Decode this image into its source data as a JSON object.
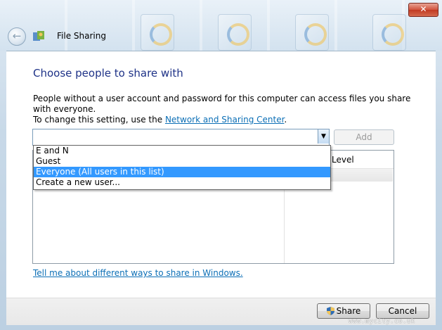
{
  "window": {
    "close_label": "✕",
    "back_icon": "back-arrow-icon",
    "title": "File Sharing"
  },
  "content": {
    "heading": "Choose people to share with",
    "description_line1": "People without a user account and password for this computer can access files you share with everyone.",
    "description_line2_prefix": "To change this setting, use the ",
    "network_link": "Network and Sharing Center",
    "description_line2_suffix": "."
  },
  "user_combo": {
    "value": "",
    "add_label": "Add"
  },
  "dropdown": {
    "options": [
      "E and N",
      "Guest",
      "Everyone (All users in this list)",
      "Create a new user..."
    ],
    "selected_index": 2
  },
  "list": {
    "permission_header": "Level"
  },
  "help_link": "Tell me about different ways to share in Windows.",
  "footer": {
    "share_label": "Share",
    "cancel_label": "Cancel"
  },
  "watermark": "www.mycity.co.uk",
  "colors": {
    "heading": "#1e3287",
    "link": "#0c6fb6",
    "selection": "#3399ff"
  }
}
